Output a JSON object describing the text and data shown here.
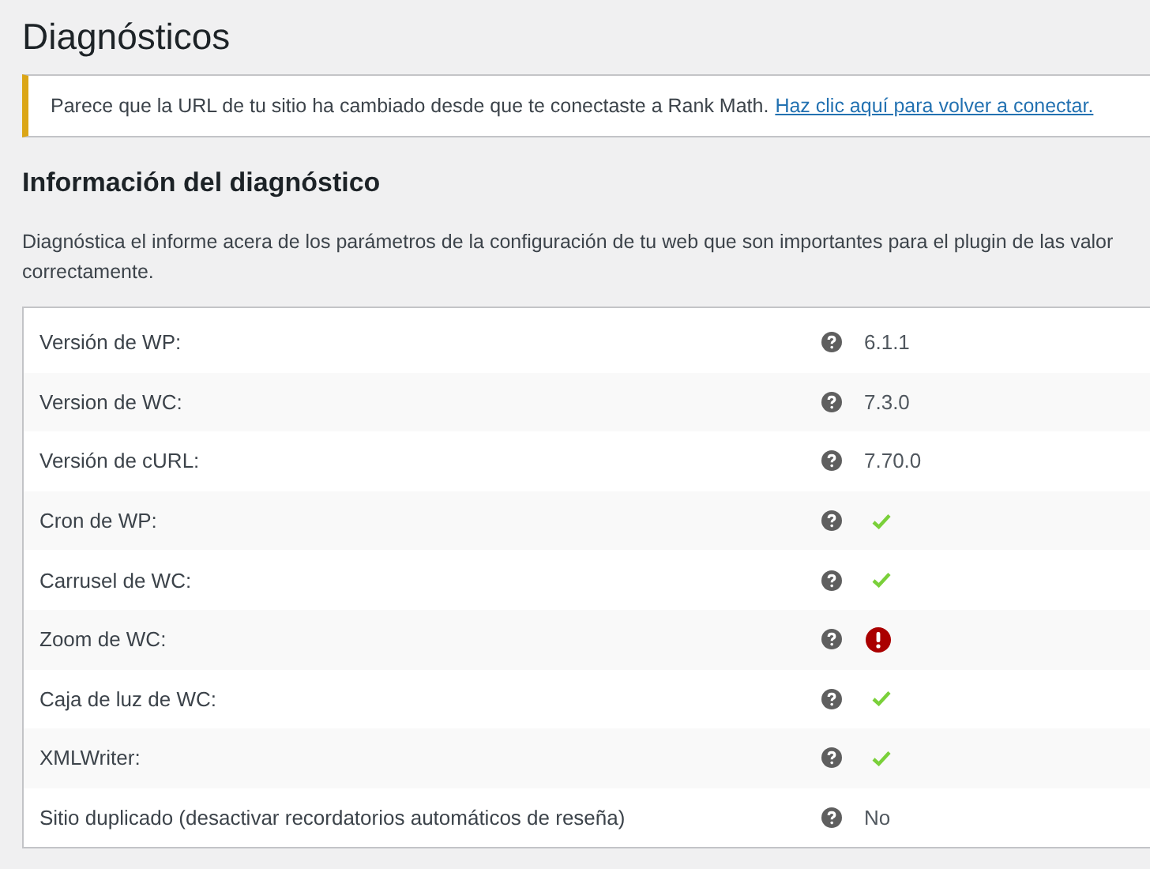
{
  "page_title": "Diagnósticos",
  "notice": {
    "text": "Parece que la URL de tu sitio ha cambiado desde que te conectaste a Rank Math.",
    "link": "Haz clic aquí para volver a conectar."
  },
  "section": {
    "heading": "Información del diagnóstico",
    "description": "Diagnóstica el informe acera de los parámetros de la configuración de tu web que son importantes para el plugin de las valor correctamente."
  },
  "rows": [
    {
      "label": "Versión de WP:",
      "kind": "text",
      "value": "6.1.1"
    },
    {
      "label": "Version de WC:",
      "kind": "text",
      "value": "7.3.0"
    },
    {
      "label": "Versión de cURL:",
      "kind": "text",
      "value": "7.70.0"
    },
    {
      "label": "Cron de WP:",
      "kind": "ok"
    },
    {
      "label": "Carrusel de WC:",
      "kind": "ok"
    },
    {
      "label": "Zoom de WC:",
      "kind": "error"
    },
    {
      "label": "Caja de luz de WC:",
      "kind": "ok"
    },
    {
      "label": "XMLWriter:",
      "kind": "ok"
    },
    {
      "label": "Sitio duplicado (desactivar recordatorios automáticos de reseña)",
      "kind": "text",
      "value": "No"
    }
  ]
}
